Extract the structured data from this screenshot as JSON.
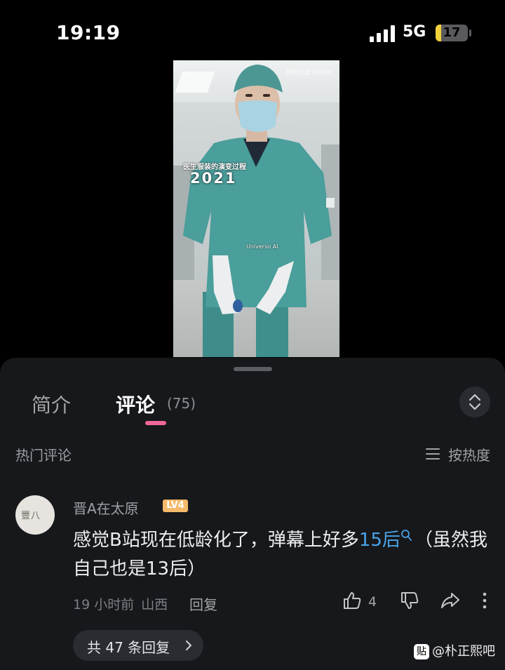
{
  "status_bar": {
    "time": "19:19",
    "network": "5G",
    "battery_level": "17",
    "battery_fraction": 0.17
  },
  "video": {
    "watermark": "风铃在此 bilibili",
    "caption_small": "医生服装的演变过程",
    "caption_year": "2021",
    "caption_mark": "Universo AI"
  },
  "tabs": {
    "intro": "简介",
    "comments": "评论",
    "comments_count": "(75)"
  },
  "section": {
    "hot_label": "热门评论",
    "sort_label": "按热度"
  },
  "comment": {
    "avatar_text": "豐八",
    "username": "晋A在太原",
    "level_badge": "LV4",
    "text_part1": "感觉B站现在低龄化了，弹幕上好多",
    "highlight": "15后",
    "text_part2": "（虽然我自己也是13后）",
    "time": "19 小时前",
    "location": "山西",
    "reply_label": "回复",
    "like_count": "4"
  },
  "replies": {
    "label": "共 47 条回复"
  },
  "source_watermark": "@朴正熙吧",
  "colors": {
    "accent": "#f0679a",
    "link": "#4aa3e8",
    "sheet_bg": "#17181b"
  }
}
